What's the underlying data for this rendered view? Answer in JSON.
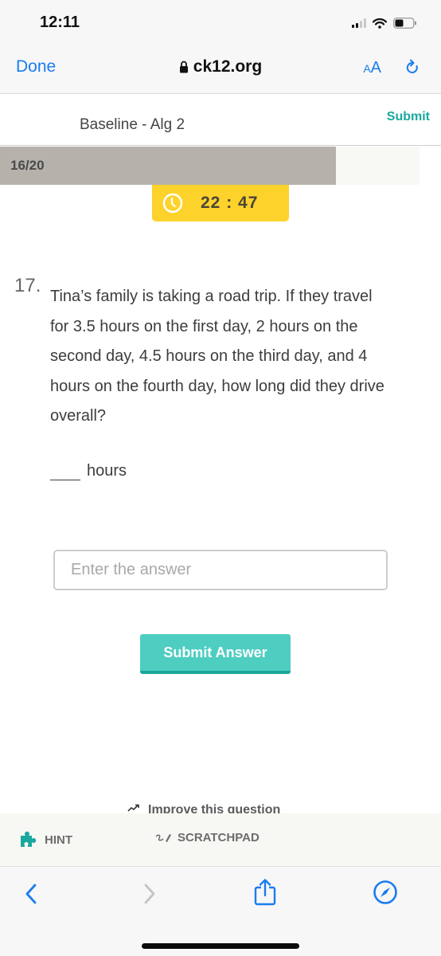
{
  "status_bar": {
    "time": "12:11",
    "signal_icon": "cellular-signal-icon",
    "wifi_icon": "wifi-icon",
    "battery_icon": "battery-icon",
    "battery_level": 0.4
  },
  "browser": {
    "done_label": "Done",
    "url": "ck12.org",
    "lock_icon": "lock-icon",
    "text_size_small": "A",
    "text_size_big": "A",
    "reload_icon": "reload-icon"
  },
  "header": {
    "title": "Baseline - Alg 2",
    "submit_label": "Submit"
  },
  "progress": {
    "label": "16/20",
    "current": 16,
    "total": 20,
    "fraction": 0.8
  },
  "timer": {
    "icon": "clock-icon",
    "text": "22 : 47",
    "color": "#fdd22a"
  },
  "question": {
    "number": "17.",
    "text": "Tina’s family is taking a road trip. If they travel for 3.5 hours on the first day, 2 hours on the second day, 4.5 hours on the third day, and 4 hours on the fourth day, how long did they drive overall?",
    "unit": "hours"
  },
  "answer": {
    "placeholder": "Enter the answer",
    "value": "",
    "submit_label": "Submit Answer",
    "accent": "#4ecdc1"
  },
  "improve": {
    "icon": "trending-icon",
    "label": "Improve this question"
  },
  "tools": {
    "hint_icon": "puzzle-icon",
    "hint_label": "HINT",
    "scratchpad_icon": "pencil-scribble-icon",
    "scratchpad_label": "SCRATCHPAD"
  },
  "bottom_nav": {
    "back_icon": "chevron-left-icon",
    "forward_icon": "chevron-right-icon",
    "share_icon": "share-icon",
    "safari_icon": "compass-icon"
  },
  "colors": {
    "ios_blue": "#1a7cf0",
    "teal": "#19a89d",
    "progress_fill": "#b6b2ab"
  }
}
